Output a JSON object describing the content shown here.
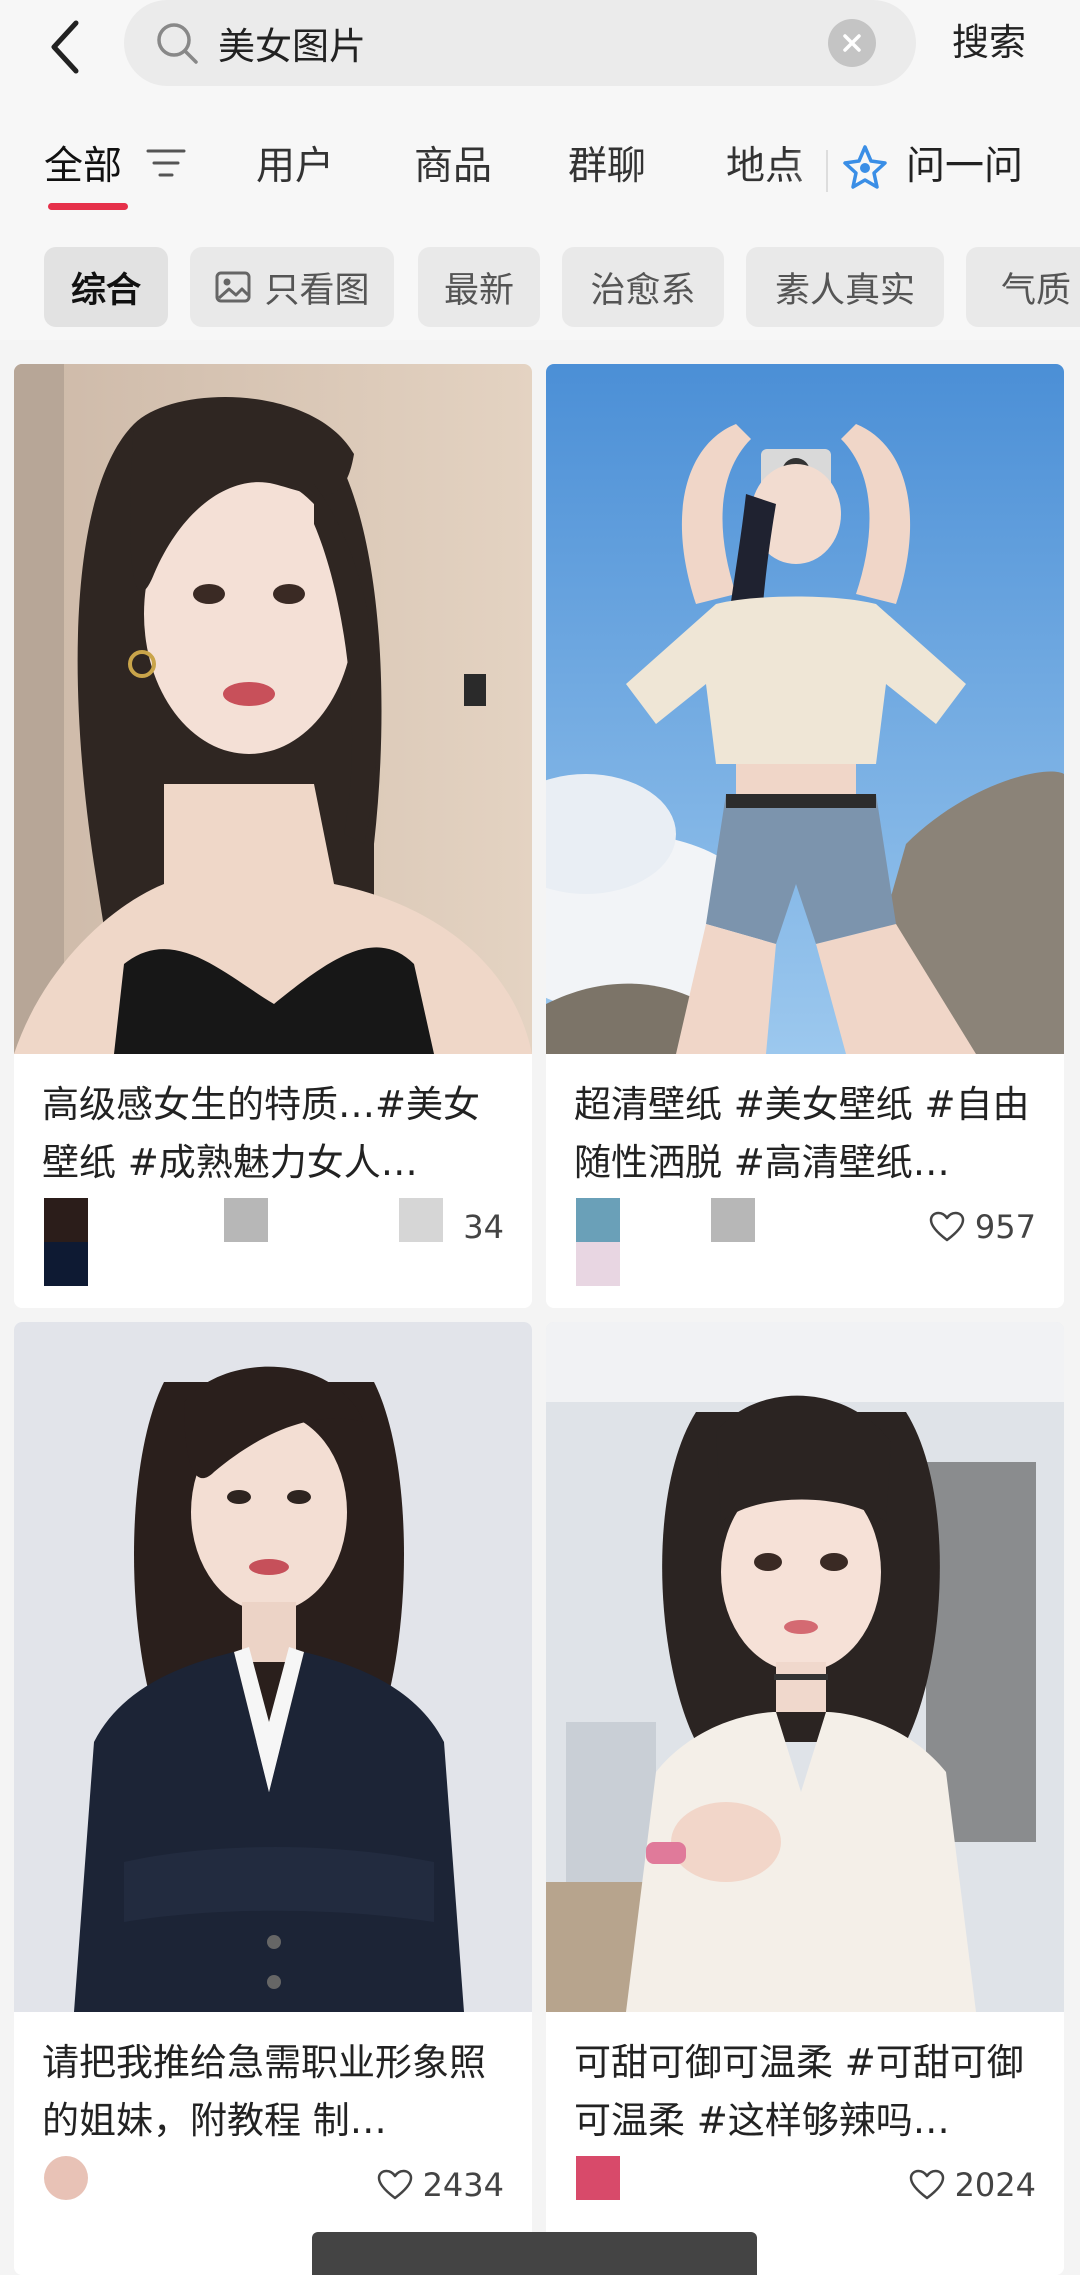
{
  "search": {
    "query": "美女图片",
    "submit_label": "搜索"
  },
  "tabs": [
    {
      "label": "全部"
    },
    {
      "label": "用户"
    },
    {
      "label": "商品"
    },
    {
      "label": "群聊"
    },
    {
      "label": "地点"
    }
  ],
  "ask_label": "问一问",
  "chips": [
    {
      "label": "综合"
    },
    {
      "label": "只看图"
    },
    {
      "label": "最新"
    },
    {
      "label": "治愈系"
    },
    {
      "label": "素人真实"
    },
    {
      "label": "气质"
    }
  ],
  "cards": [
    {
      "title": "高级感女生的特质…#美女壁纸 #成熟魅力女人…",
      "likes": "34"
    },
    {
      "title": "超清壁纸 #美女壁纸 #自由随性洒脱 #高清壁纸…",
      "likes": "957"
    },
    {
      "title": "请把我推给急需职业形象照的姐妹，附教程 制…",
      "likes": "2434"
    },
    {
      "title": "可甜可御可温柔 #可甜可御可温柔 #这样够辣吗…",
      "likes": "2024"
    }
  ],
  "colors": {
    "accent": "#e6304a",
    "ask_icon": "#3a8ee6",
    "background": "#f4f4f4"
  },
  "icons": {
    "back": "chevron-left-icon",
    "search": "search-icon",
    "clear": "close-circle-icon",
    "filter": "filter-lines-icon",
    "ask": "sparkle-star-icon",
    "image": "image-icon",
    "like": "heart-outline-icon"
  }
}
